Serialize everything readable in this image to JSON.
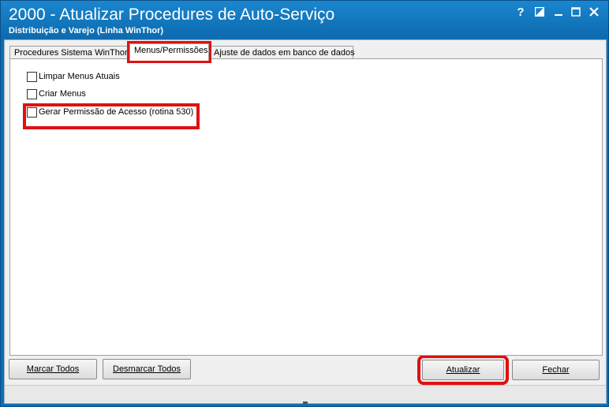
{
  "window": {
    "title": "2000 - Atualizar Procedures de Auto-Serviço",
    "subtitle": "Distribuição e Varejo (Linha WinThor)",
    "controls": [
      "help-icon",
      "restore-icon",
      "minimize-icon",
      "maximize-icon",
      "close-icon"
    ],
    "help_glyph": "?",
    "accent_color": "#0f6db5",
    "highlight_color": "#e01010"
  },
  "tabs": [
    {
      "label": "Procedures Sistema WinThor",
      "active": false
    },
    {
      "label": "Menus/Permissões",
      "active": true
    },
    {
      "label": "Ajuste de dados em banco de dados",
      "active": false
    }
  ],
  "options": [
    {
      "label": "Limpar Menus Atuais",
      "checked": false
    },
    {
      "label": "Criar Menus",
      "checked": false
    },
    {
      "label": "Gerar Permissão de Acesso (rotina 530)",
      "checked": false
    }
  ],
  "buttons": {
    "marcar_todos": "Marcar Todos",
    "desmarcar_todos": "Desmarcar Todos",
    "atualizar": "Atualizar",
    "fechar": "Fechar"
  }
}
